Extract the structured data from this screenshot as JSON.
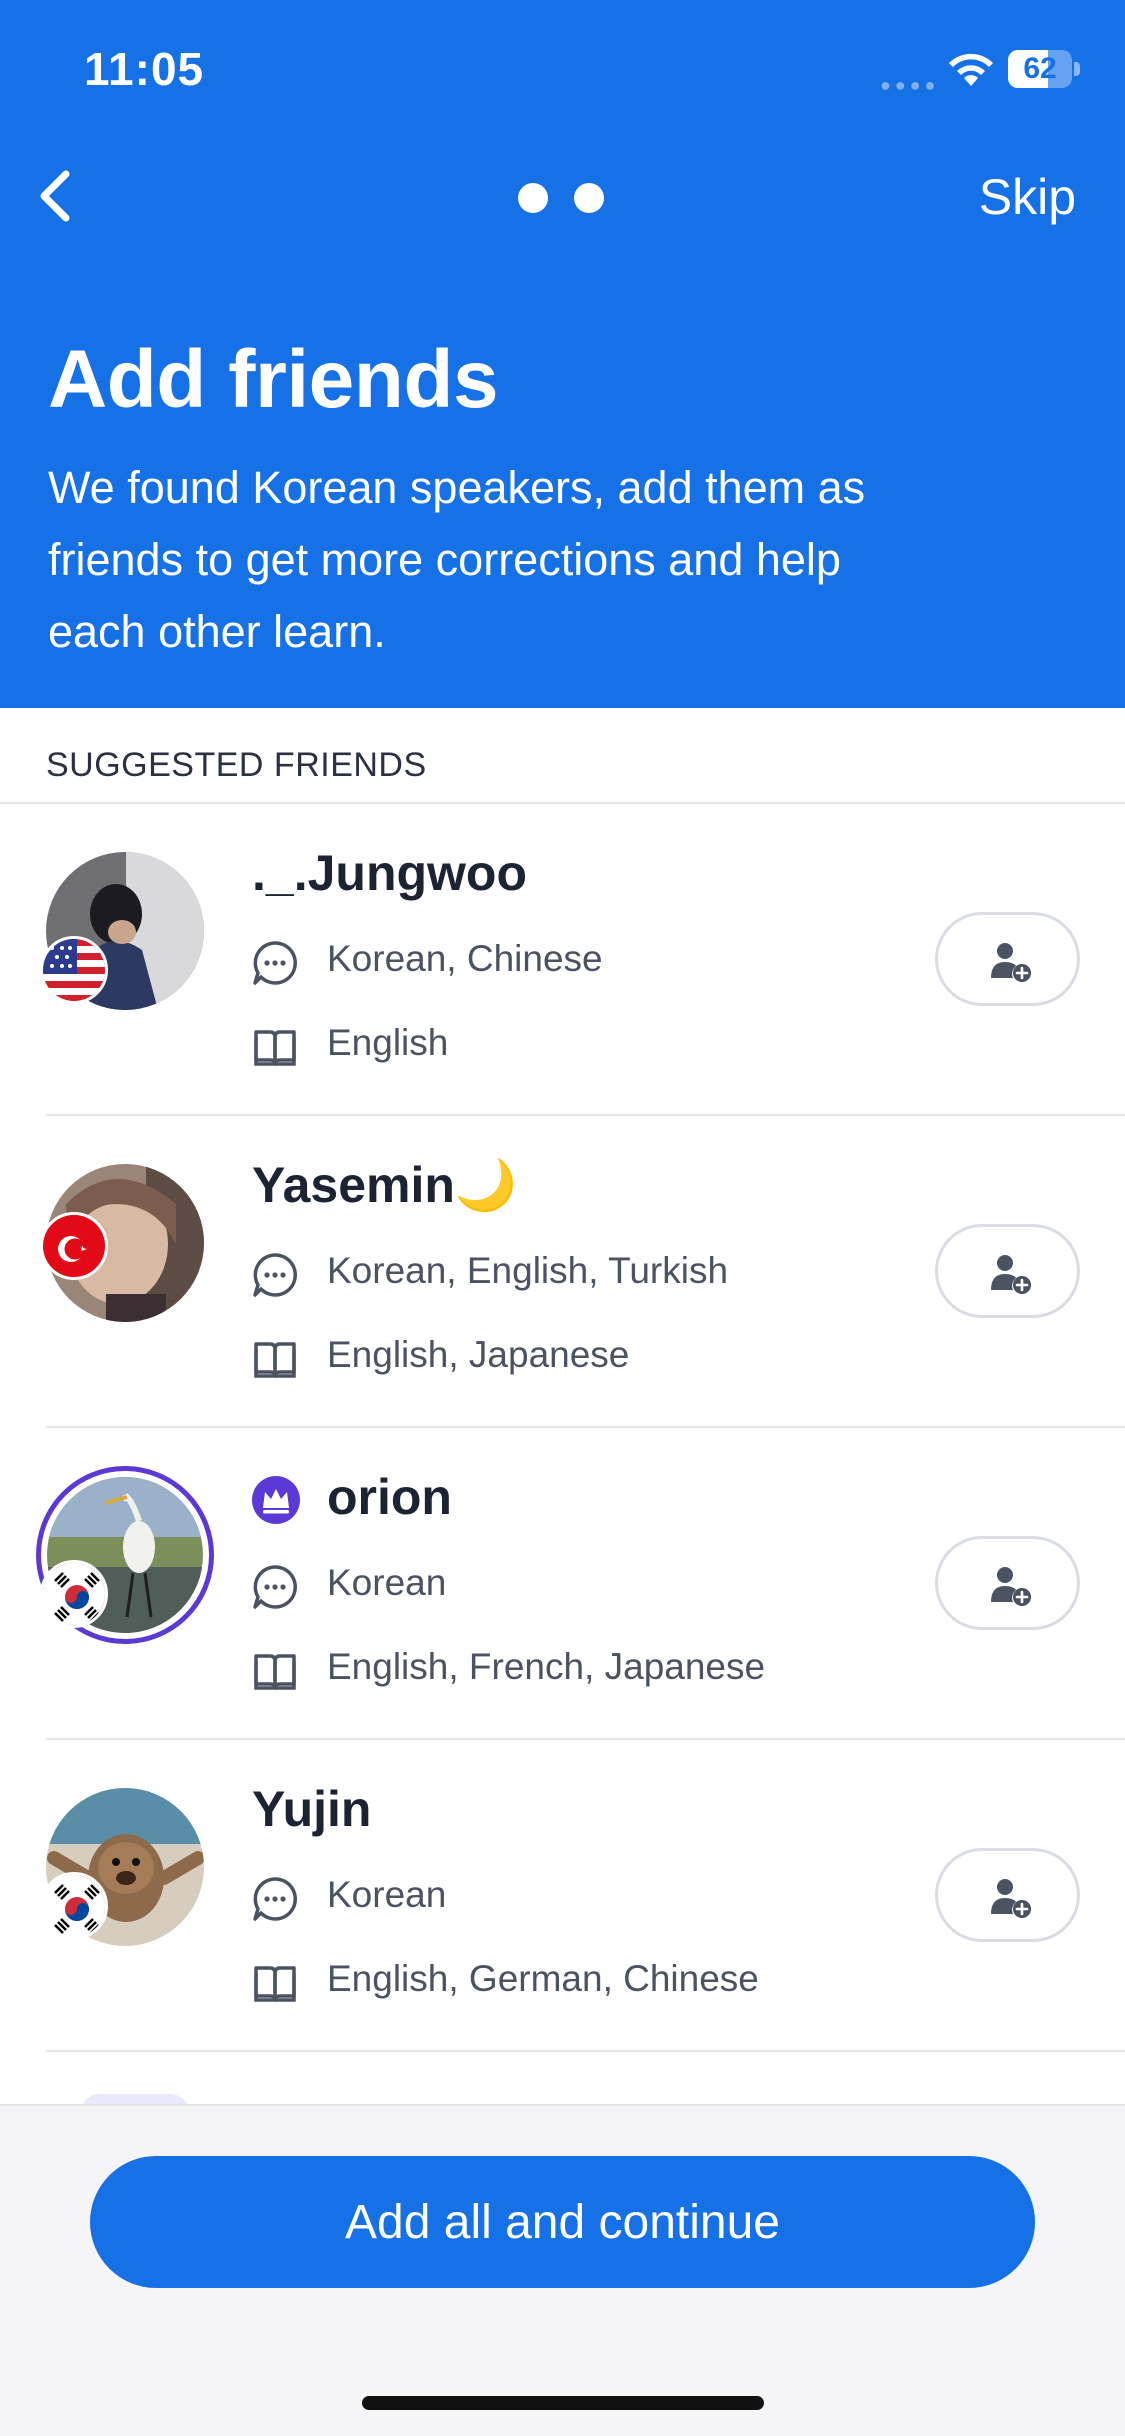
{
  "status_bar": {
    "time": "11:05",
    "battery": "62",
    "battery_level": 0.62
  },
  "nav": {
    "skip_label": "Skip",
    "pager_pages": 2
  },
  "header": {
    "title": "Add friends",
    "subtitle": "We found Korean speakers, add them as friends to get more corrections and help each other learn."
  },
  "section": {
    "title": "SUGGESTED FRIENDS"
  },
  "friends": [
    {
      "name": "._.Jungwoo",
      "speaks": "Korean, Chinese",
      "learns": "English",
      "flag": "us-flag",
      "premium": false
    },
    {
      "name": "Yasemin🌙",
      "speaks": "Korean, English, Turkish",
      "learns": "English, Japanese",
      "flag": "turkey-flag",
      "premium": false
    },
    {
      "name": "orion",
      "speaks": "Korean",
      "learns": "English, French, Japanese",
      "flag": "korea-flag",
      "premium": true
    },
    {
      "name": "Yujin",
      "speaks": "Korean",
      "learns": "English, German, Chinese",
      "flag": "korea-flag",
      "premium": false
    }
  ],
  "cta": {
    "label": "Add all and continue"
  },
  "colors": {
    "brand": "#1670e6",
    "premium": "#5a39d6",
    "text": "#1c2434",
    "muted": "#4b5262"
  }
}
